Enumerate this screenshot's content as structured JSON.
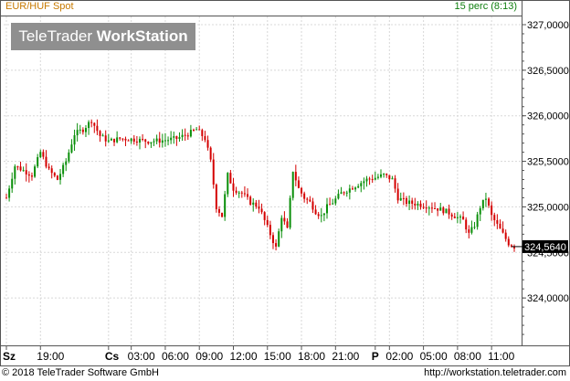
{
  "header": {
    "instrument": "EUR/HUF Spot",
    "interval": "15 perc (8:13)"
  },
  "logo": {
    "part1": "TeleTrader",
    "part2": "WorkStation"
  },
  "footer": {
    "copyright": "© 2018 TeleTrader Software GmbH",
    "url": "http://workstation.teletrader.com"
  },
  "colors": {
    "up": "#0a8f0a",
    "down": "#d40000",
    "grid": "#d8d8d8",
    "frame": "#555555"
  },
  "chart_data": {
    "type": "candlestick",
    "title": "EUR/HUF Spot",
    "interval": "15 perc",
    "ylim": [
      323.5,
      327.2
    ],
    "y_ticks": [
      "327,0000",
      "326,5000",
      "326,0000",
      "325,5000",
      "325,0000",
      "324,5000",
      "324,0000"
    ],
    "y_tick_values": [
      327.0,
      326.5,
      326.0,
      325.5,
      325.0,
      324.5,
      324.0
    ],
    "last_price": "324,5640",
    "last_value": 324.564,
    "grid": true,
    "x_labels": [
      {
        "label": "Sz",
        "bold": true,
        "index": 0
      },
      {
        "label": "19:00",
        "bold": false,
        "index": 12
      },
      {
        "label": "Cs",
        "bold": true,
        "index": 36
      },
      {
        "label": "03:00",
        "bold": false,
        "index": 44
      },
      {
        "label": "06:00",
        "bold": false,
        "index": 56
      },
      {
        "label": "09:00",
        "bold": false,
        "index": 68
      },
      {
        "label": "12:00",
        "bold": false,
        "index": 80
      },
      {
        "label": "15:00",
        "bold": false,
        "index": 92
      },
      {
        "label": "18:00",
        "bold": false,
        "index": 104
      },
      {
        "label": "21:00",
        "bold": false,
        "index": 116
      },
      {
        "label": "P",
        "bold": true,
        "index": 130
      },
      {
        "label": "02:00",
        "bold": false,
        "index": 135
      },
      {
        "label": "05:00",
        "bold": false,
        "index": 147
      },
      {
        "label": "08:00",
        "bold": false,
        "index": 159
      },
      {
        "label": "11:00",
        "bold": false,
        "index": 171
      }
    ],
    "close_path": [
      [
        0,
        325.1
      ],
      [
        3,
        325.45
      ],
      [
        6,
        325.4
      ],
      [
        9,
        325.35
      ],
      [
        12,
        325.6
      ],
      [
        15,
        325.4
      ],
      [
        18,
        325.3
      ],
      [
        21,
        325.5
      ],
      [
        24,
        325.8
      ],
      [
        27,
        325.85
      ],
      [
        30,
        325.95
      ],
      [
        33,
        325.78
      ],
      [
        36,
        325.72
      ],
      [
        40,
        325.75
      ],
      [
        45,
        325.74
      ],
      [
        50,
        325.72
      ],
      [
        55,
        325.73
      ],
      [
        60,
        325.75
      ],
      [
        64,
        325.8
      ],
      [
        67,
        325.85
      ],
      [
        70,
        325.75
      ],
      [
        72,
        325.5
      ],
      [
        74,
        325.0
      ],
      [
        76,
        324.9
      ],
      [
        78,
        325.35
      ],
      [
        80,
        325.2
      ],
      [
        83,
        325.15
      ],
      [
        86,
        325.05
      ],
      [
        89,
        325.0
      ],
      [
        91,
        324.85
      ],
      [
        93,
        324.7
      ],
      [
        95,
        324.55
      ],
      [
        97,
        324.9
      ],
      [
        99,
        324.75
      ],
      [
        101,
        325.4
      ],
      [
        103,
        325.2
      ],
      [
        105,
        325.1
      ],
      [
        107,
        325.05
      ],
      [
        109,
        324.95
      ],
      [
        111,
        324.9
      ],
      [
        113,
        325.0
      ],
      [
        115,
        325.05
      ],
      [
        118,
        325.15
      ],
      [
        121,
        325.2
      ],
      [
        124,
        325.25
      ],
      [
        127,
        325.3
      ],
      [
        130,
        325.32
      ],
      [
        133,
        325.35
      ],
      [
        136,
        325.3
      ],
      [
        138,
        325.1
      ],
      [
        141,
        325.05
      ],
      [
        145,
        325.03
      ],
      [
        150,
        325.0
      ],
      [
        155,
        324.95
      ],
      [
        158,
        324.9
      ],
      [
        161,
        324.85
      ],
      [
        163,
        324.7
      ],
      [
        165,
        324.8
      ],
      [
        167,
        325.0
      ],
      [
        169,
        325.1
      ],
      [
        171,
        324.9
      ],
      [
        173,
        324.8
      ],
      [
        175,
        324.7
      ],
      [
        177,
        324.6
      ],
      [
        179,
        324.564
      ]
    ]
  }
}
